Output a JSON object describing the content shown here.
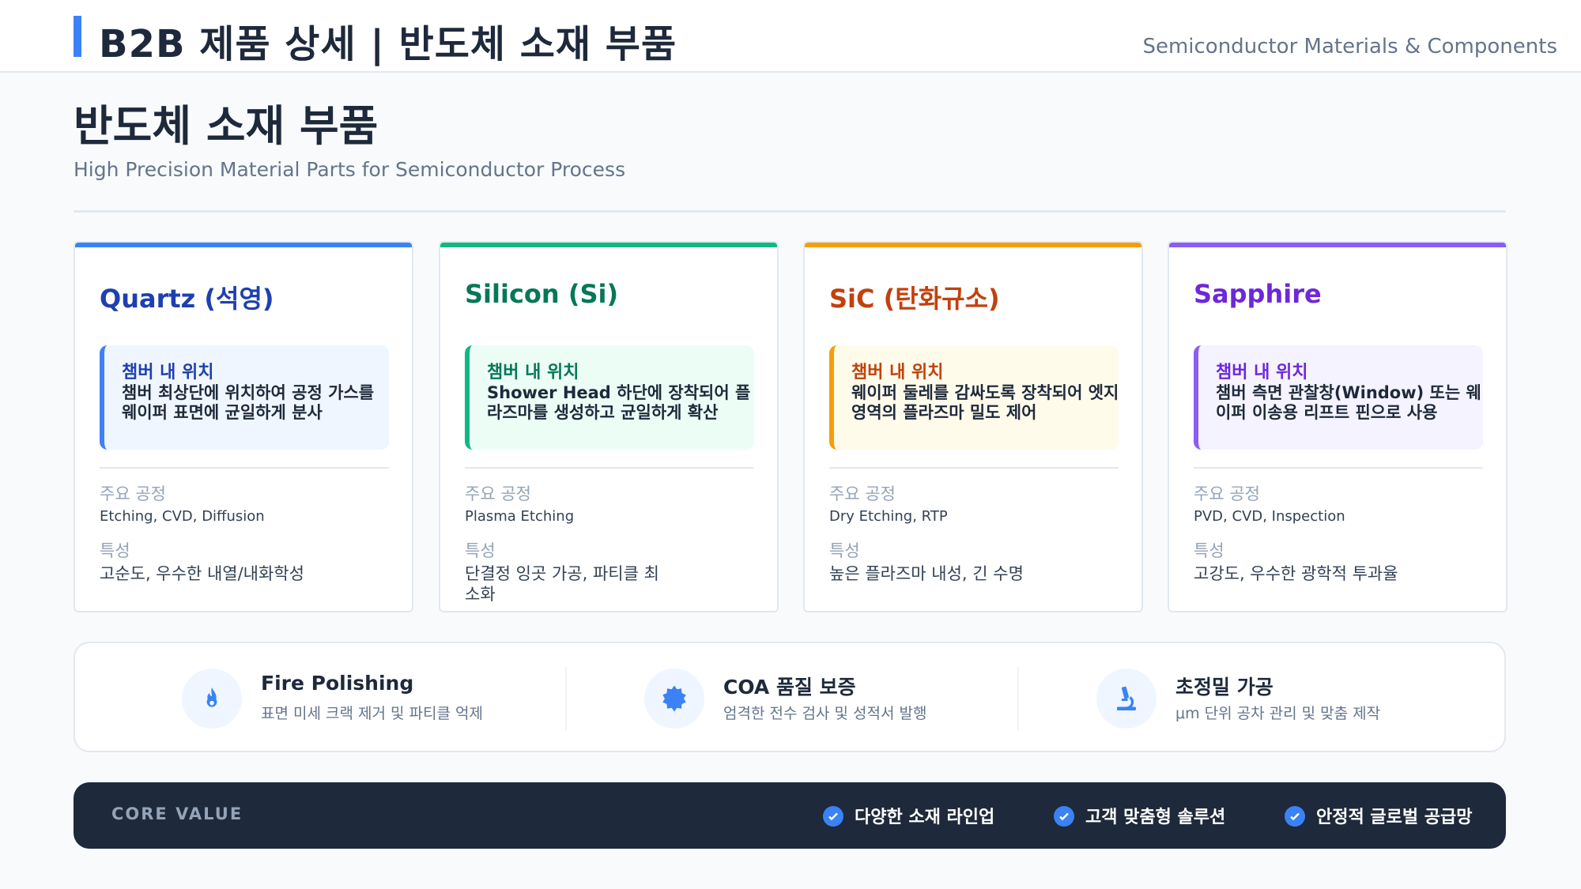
{
  "header": {
    "title": "B2B 제품 상세 | 반도체 소재 부품",
    "subtitle": "Semiconductor Materials & Components"
  },
  "page": {
    "title": "반도체 소재 부품",
    "subtitle": "High Precision Material Parts for Semiconductor Process"
  },
  "cards": [
    {
      "title": "Quartz (석영)",
      "accent": "#3b82f6",
      "title_color": "#1e40af",
      "box_bg": "#eff6ff",
      "location_label": "챔버 내 위치",
      "location_desc": "챔버 최상단에 위치하여 공정 가스를 웨이퍼 표면에 균일하게 분사",
      "process_label": "주요 공정",
      "process_value": "Etching, CVD, Diffusion",
      "feature_label": "특성",
      "feature_value": "고순도, 우수한 내열/내화학성"
    },
    {
      "title": "Silicon (Si)",
      "accent": "#10b981",
      "title_color": "#047857",
      "box_bg": "#ecfdf5",
      "location_label": "챔버 내 위치",
      "location_desc": "Shower Head 하단에 장착되어 플라즈마를 생성하고 균일하게 확산",
      "process_label": "주요 공정",
      "process_value": "Plasma Etching",
      "feature_label": "특성",
      "feature_value": "단결정 잉곳 가공, 파티클 최소화"
    },
    {
      "title": "SiC (탄화규소)",
      "accent": "#f59e0b",
      "title_color": "#c2410c",
      "box_bg": "#fffbeb",
      "location_label": "챔버 내 위치",
      "location_desc": "웨이퍼 둘레를 감싸도록 장착되어 엣지 영역의 플라즈마 밀도 제어",
      "process_label": "주요 공정",
      "process_value": "Dry Etching, RTP",
      "feature_label": "특성",
      "feature_value": "높은 플라즈마 내성, 긴 수명"
    },
    {
      "title": "Sapphire",
      "accent": "#8b5cf6",
      "title_color": "#6d28d9",
      "box_bg": "#f5f3ff",
      "location_label": "챔버 내 위치",
      "location_desc": "챔버 측면 관찰창(Window) 또는 웨이퍼 이송용 리프트 핀으로 사용",
      "process_label": "주요 공정",
      "process_value": "PVD, CVD, Inspection",
      "feature_label": "특성",
      "feature_value": "고강도, 우수한 광학적 투과율"
    }
  ],
  "features": [
    {
      "icon": "fire-icon",
      "name": "Fire Polishing",
      "desc": "표면 미세 크랙 제거 및 파티클 억제"
    },
    {
      "icon": "certificate-icon",
      "name": "COA 품질 보증",
      "desc": "엄격한 전수 검사 및 성적서 발행"
    },
    {
      "icon": "microscope-icon",
      "name": "초정밀 가공",
      "desc": "μm 단위 공차 관리 및 맞춤 제작"
    }
  ],
  "core": {
    "label": "CORE VALUE",
    "items": [
      "다양한 소재 라인업",
      "고객 맞춤형 솔루션",
      "안정적 글로벌 공급망"
    ],
    "icon": "check-circle-icon"
  }
}
